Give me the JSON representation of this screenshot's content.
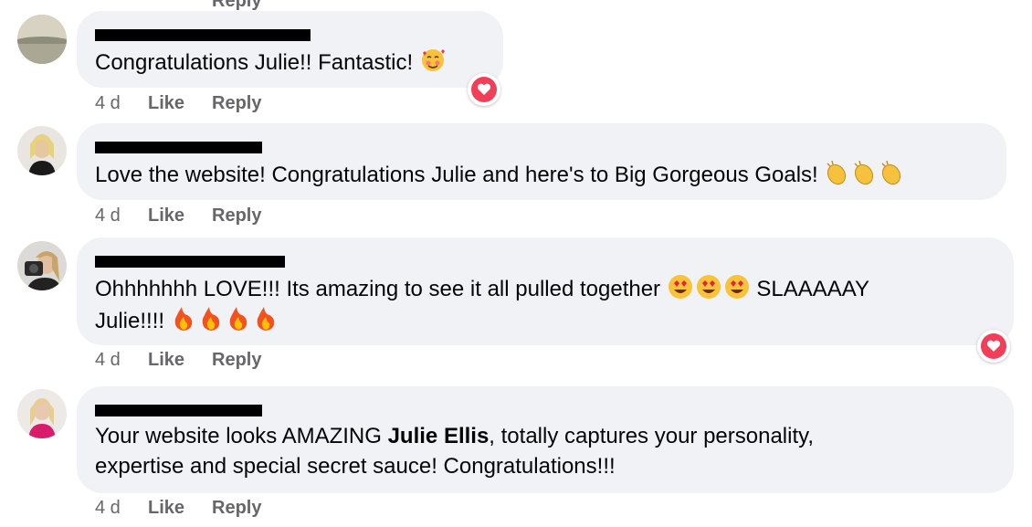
{
  "comments": [
    {
      "text": "Congratulations Julie!! Fantastic!",
      "time": "4 d",
      "like": "Like",
      "reply": "Reply",
      "emoji": "smiling-face-with-hearts",
      "reaction": "love"
    },
    {
      "text": "Love the website! Congratulations Julie and here's to Big Gorgeous Goals!",
      "time": "4 d",
      "like": "Like",
      "reply": "Reply",
      "emoji": "clapping-hands"
    },
    {
      "line1": "Ohhhhhhh LOVE!!! Its amazing to see it all pulled together",
      "line1b": "SLAAAAAY",
      "line2": "Julie!!!!",
      "time": "4 d",
      "like": "Like",
      "reply": "Reply",
      "emoji1": "heart-eyes",
      "emoji2": "fire",
      "reaction": "love"
    },
    {
      "line1_pre": "Your website looks AMAZING ",
      "mention": "Julie Ellis",
      "line1_post": ", totally captures your personality,",
      "line2": "expertise and special secret sauce! Congratulations!!!",
      "time": "4 d",
      "like": "Like",
      "reply": "Reply"
    }
  ],
  "top_partial": "Reply",
  "colors": {
    "bubble": "#f0f2f5",
    "meta": "#65676b",
    "love": "#f33e58"
  }
}
